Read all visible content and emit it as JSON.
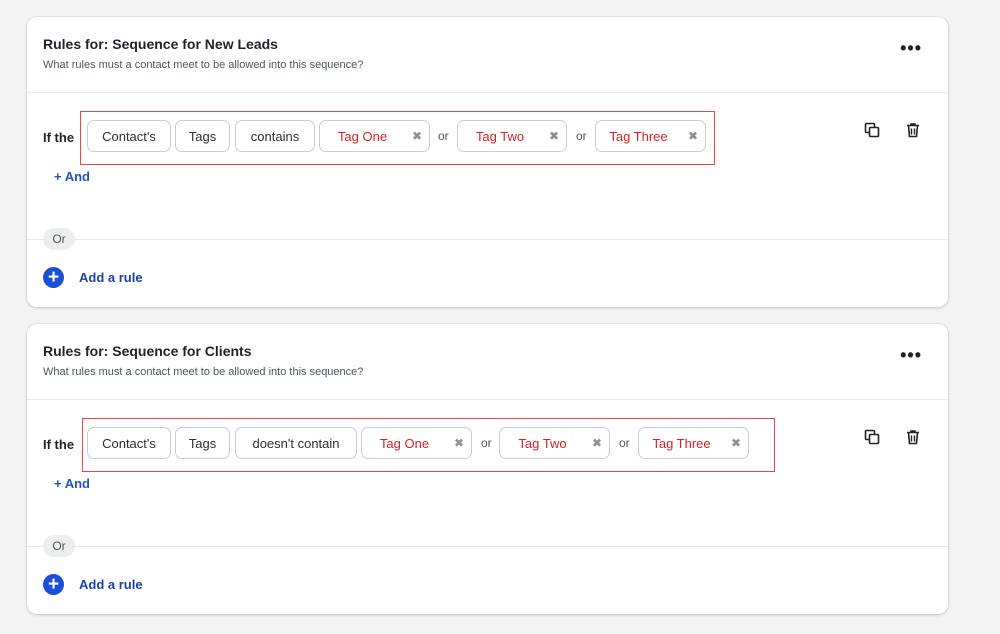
{
  "cards": [
    {
      "title": "Rules for: Sequence for New Leads",
      "subtitle": "What rules must a contact meet to be allowed into this sequence?",
      "more_label": "•••",
      "if_label": "If the",
      "field_1": "Contact's",
      "field_2": "Tags",
      "operator": "contains",
      "tags": [
        "Tag One",
        "Tag Two",
        "Tag Three"
      ],
      "or_word": "or",
      "and_label": "+ And",
      "or_badge": "Or",
      "add_rule_label": "Add a rule"
    },
    {
      "title": "Rules for: Sequence for Clients",
      "subtitle": "What rules must a contact meet to be allowed into this sequence?",
      "more_label": "•••",
      "if_label": "If the",
      "field_1": "Contact's",
      "field_2": "Tags",
      "operator": "doesn't contain",
      "tags": [
        "Tag One",
        "Tag Two",
        "Tag Three"
      ],
      "or_word": "or",
      "and_label": "+ And",
      "or_badge": "Or",
      "add_rule_label": "Add a rule"
    }
  ],
  "icons": {
    "remove": "x-icon",
    "copy": "copy-icon",
    "delete": "trash-icon",
    "add": "plus-circle-icon"
  },
  "colors": {
    "accent_blue": "#1a4fd6",
    "tag_red": "#d61f26",
    "highlight_border": "#e0474c"
  }
}
